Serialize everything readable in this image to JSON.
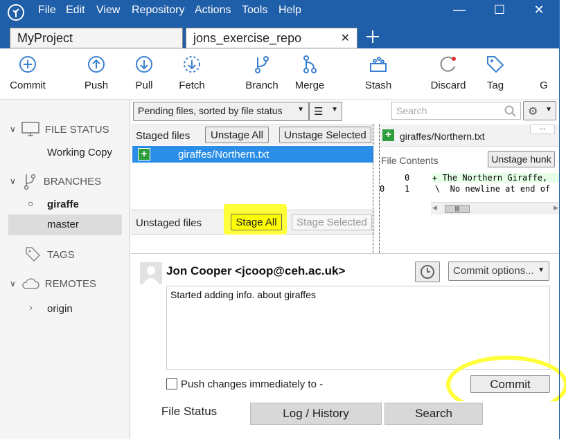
{
  "menu": {
    "items": [
      "File",
      "Edit",
      "View",
      "Repository",
      "Actions",
      "Tools",
      "Help"
    ]
  },
  "window": {
    "minimize": "—",
    "maximize": "☐",
    "close": "✕"
  },
  "tabs": [
    {
      "label": "MyProject"
    },
    {
      "label": "jons_exercise_repo",
      "close": "✕"
    }
  ],
  "toolbar": {
    "commit": "Commit",
    "push": "Push",
    "pull": "Pull",
    "fetch": "Fetch",
    "branch": "Branch",
    "merge": "Merge",
    "stash": "Stash",
    "discard": "Discard",
    "tag": "Tag",
    "git": "G"
  },
  "sidebar": {
    "file_status": "FILE STATUS",
    "working_copy": "Working Copy",
    "branches": "BRANCHES",
    "branch_current": "giraffe",
    "branch_master": "master",
    "tags": "TAGS",
    "remotes": "REMOTES",
    "origin": "origin"
  },
  "files": {
    "sort_dropdown": "Pending files, sorted by file status",
    "search_placeholder": "Search",
    "staged_label": "Staged files",
    "unstage_all": "Unstage All",
    "unstage_selected": "Unstage Selected",
    "staged_file": "giraffes/Northern.txt",
    "unstaged_label": "Unstaged files",
    "stage_all": "Stage All",
    "stage_selected": "Stage Selected"
  },
  "diff": {
    "filename": "giraffes/Northern.txt",
    "more": "...",
    "section": "File Contents",
    "unstage_hunk": "Unstage hunk",
    "line1_old": "0",
    "line1_new": "",
    "line1_text": "+ The Northern Giraffe,",
    "line2_old": "0",
    "line2_new": "1",
    "line2_text": "\\  No newline at end of"
  },
  "commit": {
    "author": "Jon Cooper <jcoop@ceh.ac.uk>",
    "options": "Commit options...",
    "message": "Started adding info. about giraffes",
    "push_label": "Push changes immediately to -",
    "button": "Commit"
  },
  "bottom_tabs": {
    "file_status": "File Status",
    "log": "Log / History",
    "search": "Search"
  },
  "colors": {
    "accent": "#1f5ea8",
    "selection": "#2a8ee8",
    "highlight": "#ffff00",
    "added": "#2e9e3c"
  }
}
